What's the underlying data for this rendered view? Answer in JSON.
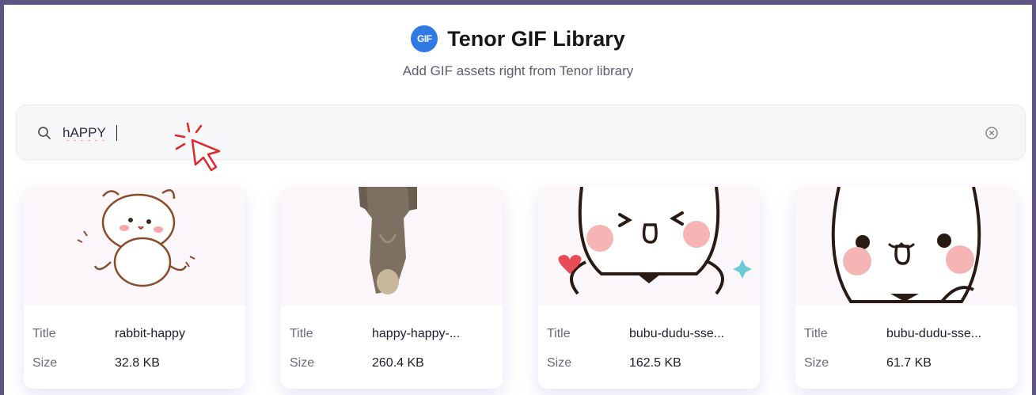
{
  "header": {
    "logo_text": "GIF",
    "title": "Tenor GIF Library",
    "subtitle": "Add GIF assets right from Tenor library"
  },
  "search": {
    "value": "hAPPY",
    "icon": "search-icon",
    "clear_icon": "clear-icon"
  },
  "results": [
    {
      "title_label": "Title",
      "title": "rabbit-happy",
      "size_label": "Size",
      "size": "32.8 KB"
    },
    {
      "title_label": "Title",
      "title": "happy-happy-...",
      "size_label": "Size",
      "size": "260.4 KB"
    },
    {
      "title_label": "Title",
      "title": "bubu-dudu-sse...",
      "size_label": "Size",
      "size": "162.5 KB"
    },
    {
      "title_label": "Title",
      "title": "bubu-dudu-sse...",
      "size_label": "Size",
      "size": "61.7 KB"
    }
  ],
  "colors": {
    "frame": "#5f5585",
    "accent": "#2f7ae5",
    "cursor": "#e0262a"
  }
}
